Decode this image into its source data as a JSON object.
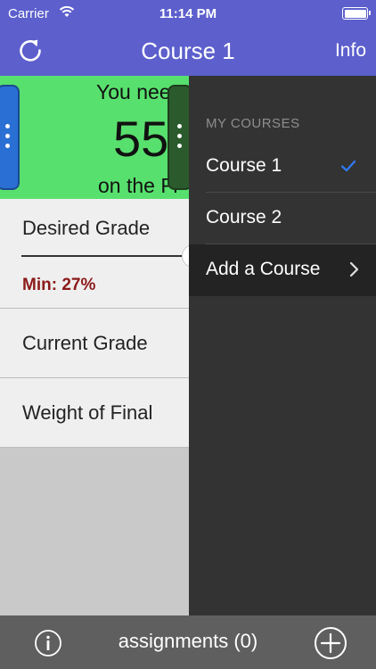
{
  "status": {
    "carrier": "Carrier",
    "time": "11:14 PM"
  },
  "nav": {
    "title": "Course 1",
    "info_label": "Info",
    "refresh_icon": "refresh-icon"
  },
  "banner": {
    "needs_text": "You nee",
    "big_value": "55",
    "final_text": "on the Fi",
    "color": "#58e06e"
  },
  "form": {
    "desired_grade_label": "Desired Grade",
    "min_text": "Min: 27%",
    "current_grade_label": "Current Grade",
    "weight_of_final_label": "Weight of Final"
  },
  "drawer": {
    "section_title": "MY COURSES",
    "items": [
      {
        "label": "Course 1",
        "selected": true
      },
      {
        "label": "Course 2",
        "selected": false
      },
      {
        "label": "Add a Course",
        "selected": false
      }
    ]
  },
  "bottom": {
    "assignments_label": "assignments (0)"
  },
  "colors": {
    "nav_bar": "#5c5fcc",
    "drawer": "#333333",
    "accent_check": "#2f7df6",
    "min_text": "#8b1a1a",
    "bottom_bar": "#5f5f5f"
  }
}
